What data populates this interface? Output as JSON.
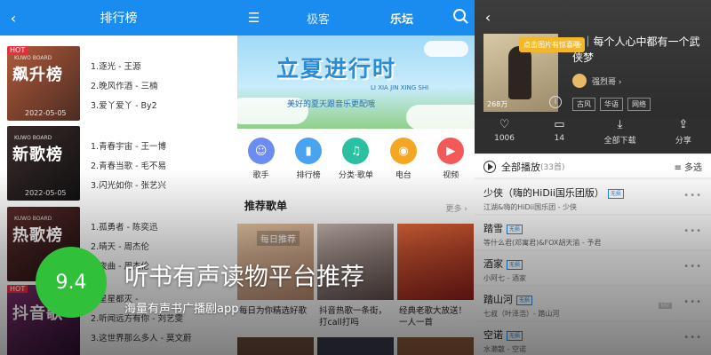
{
  "left_panel": {
    "title": "排行榜",
    "charts": [
      {
        "name": "飙升榜",
        "hot": "HOT",
        "brand": "KUWO BOARD",
        "date": "2022-05-05",
        "songs": [
          "1.逐光 - 王源",
          "2.晚风作酒 - 三楠",
          "3.爱丫爱丫 - By2"
        ]
      },
      {
        "name": "新歌榜",
        "hot": "",
        "brand": "KUWO BOARD",
        "date": "2022-05-05",
        "songs": [
          "1.青春宇宙 - 王一博",
          "2.青春当歌 - 毛不易",
          "3.闪光如你 - 张艺兴"
        ]
      },
      {
        "name": "热歌榜",
        "hot": "",
        "brand": "KUWO BOARD",
        "date": "",
        "songs": [
          "1.孤勇者 - 陈奕迅",
          "2.晴天 - 周杰伦",
          "3.夜曲 - 周杰伦"
        ]
      },
      {
        "name": "抖音歌",
        "hot": "HOT",
        "brand": "",
        "date": "",
        "songs": [
          "1.星星都灭 - ",
          "2.听闻远方有你 - 刘艺雯",
          "3.这世界那么多人 - 莫文蔚"
        ]
      }
    ]
  },
  "middle_panel": {
    "tabs": [
      "极客",
      "乐坛"
    ],
    "banner": {
      "title": "立夏进行时",
      "pinyin": "LI XIA\nJIN XING SHI",
      "subtitle": "美好的夏天跟音乐更配哦"
    },
    "shortcuts": [
      {
        "label": "歌手",
        "icon": "singer-icon",
        "color": "#6b8cf3"
      },
      {
        "label": "排行榜",
        "icon": "chart-icon",
        "color": "#4aa3f0"
      },
      {
        "label": "分类·歌单",
        "icon": "category-icon",
        "color": "#2bc0a0"
      },
      {
        "label": "电台",
        "icon": "radio-icon",
        "color": "#f5a623"
      },
      {
        "label": "视频",
        "icon": "video-icon",
        "color": "#f25a5a"
      }
    ],
    "section_title": "推荐歌单",
    "more": "更多 ›",
    "playlists": [
      {
        "caption": "每日为你精选好歌",
        "tile_text": "每日推荐"
      },
      {
        "caption": "抖音热歌一条街，打call打吗",
        "tile_text": ""
      },
      {
        "caption": "经典老歌大放送！一人一首",
        "tile_text": ""
      }
    ]
  },
  "right_panel": {
    "tip": "点击图片有惊喜哦",
    "title": "...｜每个人心中都有一个武侠梦",
    "author": "强烈哥 ›",
    "play_count": "268万",
    "tags": [
      "古风",
      "华语",
      "网络"
    ],
    "actions": [
      {
        "label": "1006",
        "icon": "like-icon",
        "glyph": "♡"
      },
      {
        "label": "14",
        "icon": "comment-icon",
        "glyph": "▭"
      },
      {
        "label": "全部下载",
        "icon": "download-icon",
        "glyph": "⤓"
      },
      {
        "label": "分享",
        "icon": "share-icon",
        "glyph": "⇪"
      }
    ],
    "play_all": "全部播放",
    "count": "(33首)",
    "multi_select": "≡ 多选",
    "songs": [
      {
        "title": "少侠（嗨的HiDii国乐团版）",
        "badge": "无损",
        "sub": "江湖&嗨的HiDii国乐团 - 少侠",
        "mv": ""
      },
      {
        "title": "踏雪",
        "badge": "无损",
        "sub": "等什么君(邓寓君)&FOX胡天渝 - 予君",
        "mv": ""
      },
      {
        "title": "酒家",
        "badge": "无损",
        "sub": "小阿七 - 酒家",
        "mv": ""
      },
      {
        "title": "踏山河",
        "badge": "无损",
        "sub": "七叔（叶泽浩）- 踏山河",
        "mv": "MV"
      },
      {
        "title": "空诺",
        "badge": "无损",
        "sub": "水濑散 - 空诺",
        "mv": ""
      }
    ]
  },
  "overlay": {
    "score": "9.4",
    "headline": "听书有声读物平台推荐",
    "subtitle": "海量有声书广播剧app"
  }
}
